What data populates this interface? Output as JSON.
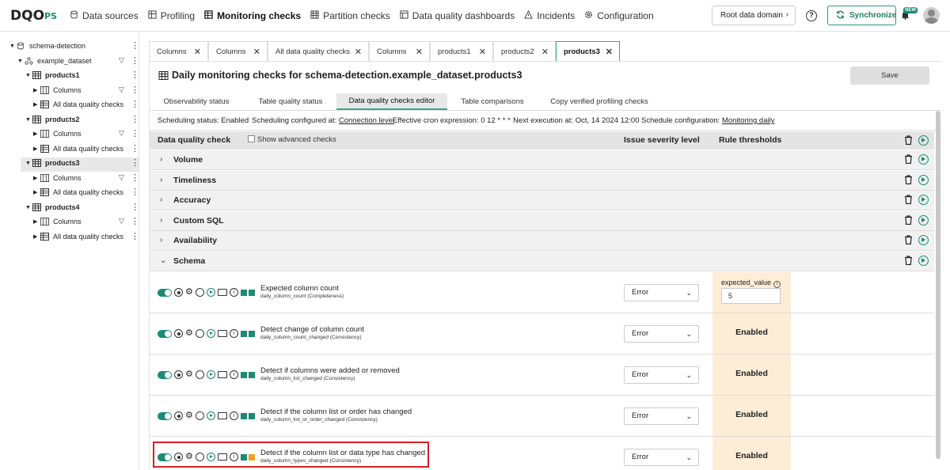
{
  "app": {
    "logo_text": "DQO",
    "logo_suffix": "PS"
  },
  "nav": {
    "items": [
      {
        "label": "Data sources",
        "icon": "data-sources-icon",
        "active": false
      },
      {
        "label": "Profiling",
        "icon": "profiling-icon",
        "active": false
      },
      {
        "label": "Monitoring checks",
        "icon": "monitoring-icon",
        "active": true
      },
      {
        "label": "Partition checks",
        "icon": "partition-icon",
        "active": false
      },
      {
        "label": "Data quality dashboards",
        "icon": "dashboard-icon",
        "active": false
      },
      {
        "label": "Incidents",
        "icon": "warning-icon",
        "active": false
      },
      {
        "label": "Configuration",
        "icon": "gear-icon",
        "active": false
      }
    ],
    "root_domain": "Root data domain",
    "sync_label": "Synchronize",
    "new_badge": "NEW",
    "help_glyph": "?"
  },
  "sidebar": {
    "connection": "schema-detection",
    "schema": "example_dataset",
    "tables": [
      {
        "name": "products1",
        "columns": "Columns",
        "checks": "All data quality checks"
      },
      {
        "name": "products2",
        "columns": "Columns",
        "checks": "All data quality checks"
      },
      {
        "name": "products3",
        "columns": "Columns",
        "checks": "All data quality checks"
      },
      {
        "name": "products4",
        "columns": "Columns",
        "checks": "All data quality checks"
      }
    ],
    "selected_table": "products3"
  },
  "tabs": [
    {
      "label": "Columns",
      "active": false
    },
    {
      "label": "Columns",
      "active": false
    },
    {
      "label": "All data quality checks",
      "active": false
    },
    {
      "label": "Columns",
      "active": false
    },
    {
      "label": "products1",
      "active": false
    },
    {
      "label": "products2",
      "active": false
    },
    {
      "label": "products3",
      "active": true
    }
  ],
  "page": {
    "title": "Daily monitoring checks for schema-detection.example_dataset.products3",
    "save_label": "Save",
    "subtabs": [
      {
        "label": "Observability status",
        "active": false
      },
      {
        "label": "Table quality status",
        "active": false
      },
      {
        "label": "Data quality checks editor",
        "active": true
      },
      {
        "label": "Table comparisons",
        "active": false
      },
      {
        "label": "Copy verified profiling checks",
        "active": false
      }
    ],
    "schedule": {
      "status_label": "Scheduling status:",
      "status_value": "Enabled",
      "configured_label": "Scheduling configured at:",
      "configured_value": "Connection level",
      "cron_label": "Effective cron expression:",
      "cron_value": "0 12 * * *",
      "next_label": "Next execution at:",
      "next_value": "Oct, 14 2024 12:00",
      "config_label": "Schedule configuration:",
      "config_value": "Monitoring daily"
    },
    "table_header": {
      "check": "Data quality check",
      "advanced": "Show advanced checks",
      "severity": "Issue severity level",
      "thresholds": "Rule thresholds"
    },
    "categories": [
      "Volume",
      "Timeliness",
      "Accuracy",
      "Custom SQL",
      "Availability",
      "Schema"
    ],
    "checks": [
      {
        "name": "Expected column count",
        "sub": "daily_column_count (Completeness)",
        "severity": "Error",
        "rule": "input",
        "param_label": "expected_value",
        "param_value": "5",
        "colors": [
          "#1c8a74",
          "#1c8a74"
        ]
      },
      {
        "name": "Detect change of column count",
        "sub": "daily_column_count_changed (Consistency)",
        "severity": "Error",
        "rule": "Enabled",
        "colors": [
          "#1c8a74",
          "#1c8a74"
        ]
      },
      {
        "name": "Detect if columns were added or removed",
        "sub": "daily_column_list_changed (Consistency)",
        "severity": "Error",
        "rule": "Enabled",
        "colors": [
          "#1c8a74",
          "#1c8a74"
        ]
      },
      {
        "name": "Detect if the column list or order has changed",
        "sub": "daily_column_list_or_order_changed (Consistency)",
        "severity": "Error",
        "rule": "Enabled",
        "colors": [
          "#1c8a74",
          "#1c8a74"
        ]
      },
      {
        "name": "Detect if the column list or data type has changed",
        "sub": "daily_column_types_changed (Consistency)",
        "severity": "Error",
        "rule": "Enabled",
        "colors": [
          "#1c8a74",
          "#f0a020"
        ]
      }
    ]
  },
  "colors": {
    "accent": "#1c8a74",
    "highlight": "#d81f26",
    "rule_bg": "#fdecd6"
  }
}
